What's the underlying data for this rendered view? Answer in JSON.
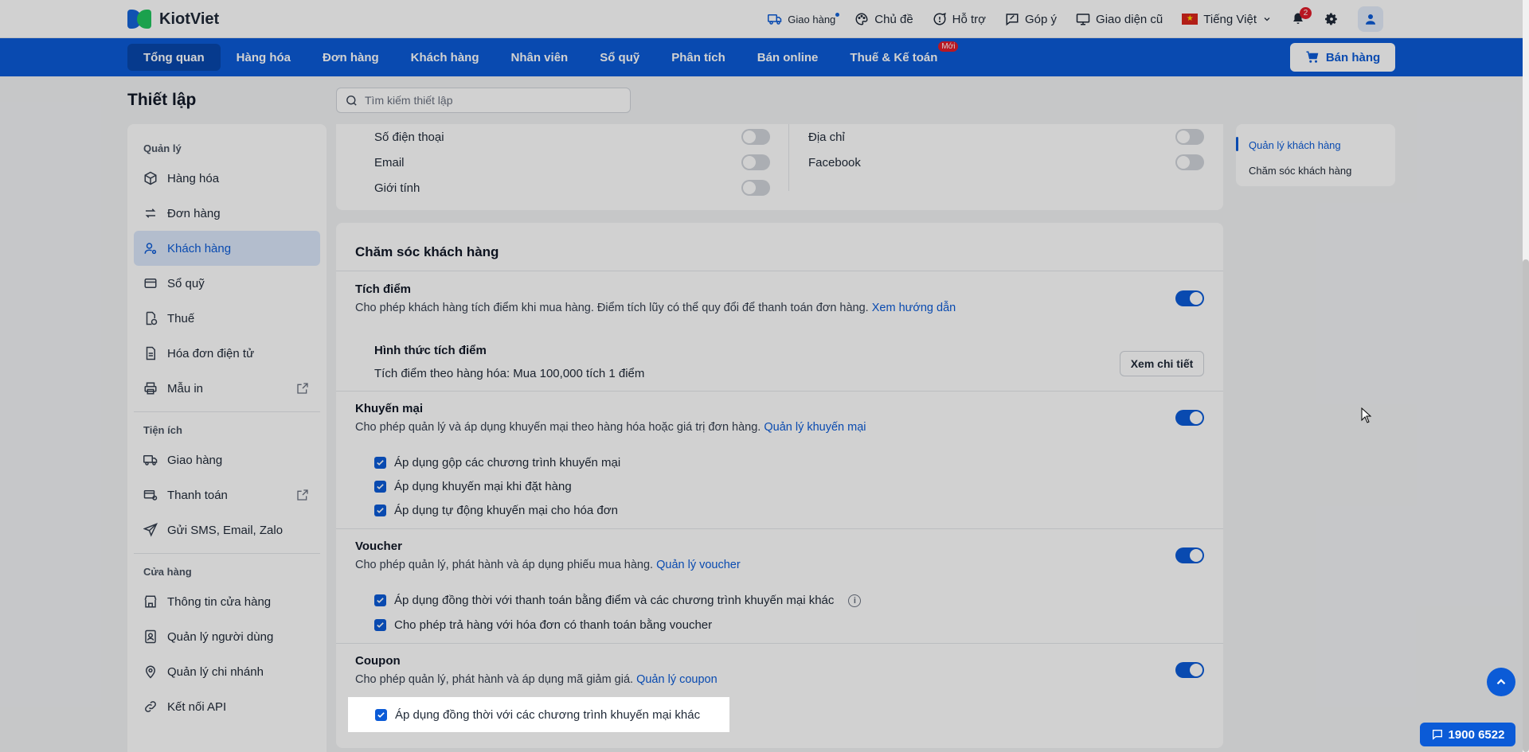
{
  "app": {
    "brand": "KiotViet",
    "accent_color": "#0b5bd7"
  },
  "top_actions": {
    "delivery": "Giao hàng",
    "theme": "Chủ đề",
    "support": "Hỗ trợ",
    "feedback": "Góp ý",
    "old_ui": "Giao diện cũ",
    "language": "Tiếng Việt",
    "notification_count": "2"
  },
  "nav": {
    "items": [
      "Tổng quan",
      "Hàng hóa",
      "Đơn hàng",
      "Khách hàng",
      "Nhân viên",
      "Sổ quỹ",
      "Phân tích",
      "Bán online",
      "Thuế & Kế toán"
    ],
    "new_badge": "Mới",
    "sell_button": "Bán hàng"
  },
  "page": {
    "title": "Thiết lập",
    "search_placeholder": "Tìm kiếm thiết lập"
  },
  "sidebar": {
    "group_manage": "Quản lý",
    "manage_items": [
      "Hàng hóa",
      "Đơn hàng",
      "Khách hàng",
      "Sổ quỹ",
      "Thuế",
      "Hóa đơn điện tử",
      "Mẫu in"
    ],
    "group_utilities": "Tiện ích",
    "utility_items": [
      "Giao hàng",
      "Thanh toán",
      "Gửi SMS, Email, Zalo"
    ],
    "group_store": "Cửa hàng",
    "store_items": [
      "Thông tin cửa hàng",
      "Quản lý người dùng",
      "Quản lý chi nhánh",
      "Kết nối API"
    ]
  },
  "info_fields": {
    "left": [
      "Số điện thoại",
      "Email",
      "Giới tính"
    ],
    "right": [
      "Địa chỉ",
      "Facebook"
    ]
  },
  "care": {
    "title": "Chăm sóc khách hàng",
    "points": {
      "title": "Tích điểm",
      "desc": "Cho phép khách hàng tích điểm khi mua hàng. Điểm tích lũy có thể quy đổi để thanh toán đơn hàng.",
      "link": "Xem hướng dẫn",
      "sub_title": "Hình thức tích điểm",
      "sub_text": "Tích điểm theo hàng hóa: Mua 100,000 tích 1 điểm",
      "detail_button": "Xem chi tiết"
    },
    "promo": {
      "title": "Khuyến mại",
      "desc": "Cho phép quản lý và áp dụng khuyến mại theo hàng hóa hoặc giá trị đơn hàng.",
      "link": "Quản lý khuyến mại",
      "options": [
        "Áp dụng gộp các chương trình khuyến mại",
        "Áp dụng khuyến mại khi đặt hàng",
        "Áp dụng tự động khuyến mại cho hóa đơn"
      ]
    },
    "voucher": {
      "title": "Voucher",
      "desc": "Cho phép quản lý, phát hành và áp dụng phiếu mua hàng.",
      "link": "Quản lý voucher",
      "options": [
        "Áp dụng đồng thời với thanh toán bằng điểm và các chương trình khuyến mại khác",
        "Cho phép trả hàng với hóa đơn có thanh toán bằng voucher"
      ]
    },
    "coupon": {
      "title": "Coupon",
      "desc": "Cho phép quản lý, phát hành và áp dụng mã giảm giá.",
      "link": "Quản lý coupon",
      "options": [
        "Áp dụng đồng thời với các chương trình khuyến mại khác"
      ]
    }
  },
  "toc": [
    "Quản lý khách hàng",
    "Chăm sóc khách hàng"
  ],
  "hotline": "1900 6522"
}
